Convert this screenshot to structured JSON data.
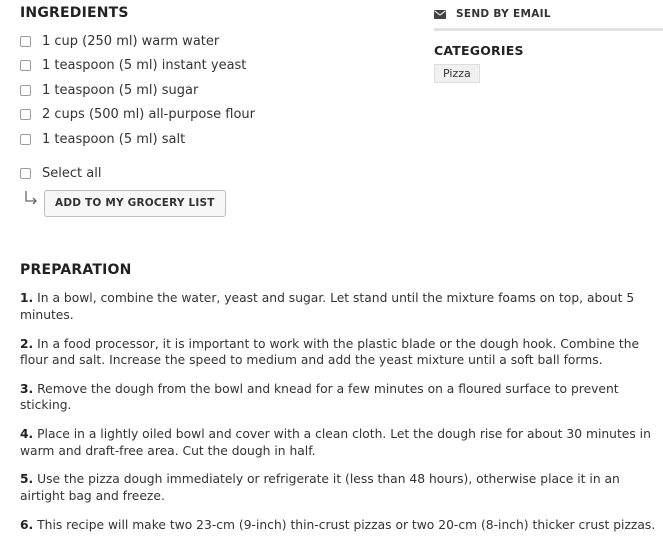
{
  "ingredients": {
    "heading": "INGREDIENTS",
    "items": [
      "1 cup (250 ml) warm water",
      "1 teaspoon (5 ml) instant yeast",
      "1 teaspoon (5 ml) sugar",
      "2 cups (500 ml) all-purpose flour",
      "1 teaspoon (5 ml) salt"
    ],
    "select_all_label": "Select all",
    "grocery_button_label": "ADD TO MY GROCERY LIST"
  },
  "sidebar": {
    "email_icon": "envelope-icon",
    "email_label": "SEND BY EMAIL",
    "categories_heading": "CATEGORIES",
    "tags": [
      "Pizza"
    ]
  },
  "preparation": {
    "heading": "PREPARATION",
    "steps": [
      {
        "num": "1.",
        "text": " In a bowl, combine the water, yeast and sugar. Let stand until the mixture foams on top, about 5 minutes."
      },
      {
        "num": "2.",
        "text": " In a food processor, it is important to work with the plastic blade or the dough hook. Combine the flour and salt. Increase the speed to medium and add the yeast mixture until a soft ball forms."
      },
      {
        "num": "3.",
        "text": " Remove the dough from the bowl and knead for a few minutes on a floured surface to prevent sticking."
      },
      {
        "num": "4.",
        "text": " Place in a lightly oiled bowl and cover with a clean cloth. Let the dough rise for about 30 minutes in warm and draft-free area. Cut the dough in half."
      },
      {
        "num": "5.",
        "text": " Use the pizza dough immediately or refrigerate it (less than 48 hours), otherwise place it in an airtight bag and freeze."
      },
      {
        "num": "6.",
        "text": " This recipe will make two 23-cm (9-inch) thin-crust pizzas or two 20-cm (8-inch) thicker crust pizzas."
      }
    ]
  },
  "colors": {
    "text": "#2b2b2b",
    "button_bg": "#f7f7f7",
    "tag_bg": "#f0f0f0",
    "rule": "#e1e1e1"
  }
}
